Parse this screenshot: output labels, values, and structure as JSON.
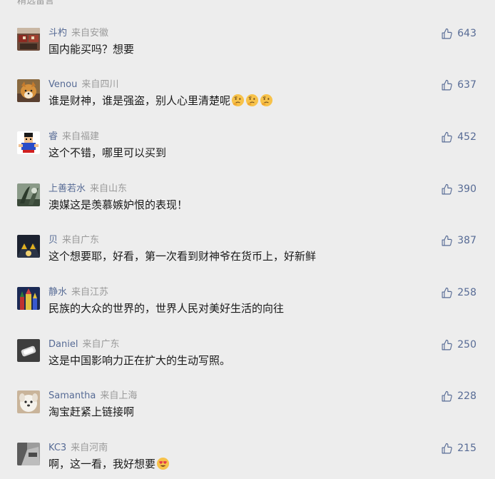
{
  "section_title": "精选留言",
  "comments": [
    {
      "nickname": "斗杓",
      "location": "来自安徽",
      "text": "国内能买吗？想要",
      "likes": "643",
      "emoji": []
    },
    {
      "nickname": "Venou",
      "location": "来自四川",
      "text": "谁是财神，谁是强盗，别人心里清楚呢",
      "likes": "637",
      "emoji": [
        "thinking-face",
        "thinking-face",
        "thinking-face"
      ]
    },
    {
      "nickname": "睿",
      "location": "来自福建",
      "text": "这个不错，哪里可以买到",
      "likes": "452",
      "emoji": []
    },
    {
      "nickname": "上善若水",
      "location": "来自山东",
      "text": "澳媒这是羡慕嫉妒恨的表现！",
      "likes": "390",
      "emoji": []
    },
    {
      "nickname": "贝",
      "location": "来自广东",
      "text": "这个想要耶，好看，第一次看到财神爷在货币上，好新鲜",
      "likes": "387",
      "emoji": []
    },
    {
      "nickname": "静水",
      "location": "来自江苏",
      "text": "民族的大众的世界的，世界人民对美好生活的向往",
      "likes": "258",
      "emoji": []
    },
    {
      "nickname": "Daniel",
      "location": "来自广东",
      "text": "这是中国影响力正在扩大的生动写照。",
      "likes": "250",
      "emoji": []
    },
    {
      "nickname": "Samantha",
      "location": "来自上海",
      "text": "淘宝赶紧上链接啊",
      "likes": "228",
      "emoji": []
    },
    {
      "nickname": "KC3",
      "location": "来自河南",
      "text": "啊，这一看，我好想要",
      "likes": "215",
      "emoji": [
        "heart-eyes-face"
      ]
    }
  ],
  "colors": {
    "background": "#ededed",
    "nickname": "#576b95",
    "location": "#9a9a9a",
    "text": "#191919",
    "like": "#576b95"
  },
  "icons": {
    "like": "thumbs-up-outline-icon"
  }
}
